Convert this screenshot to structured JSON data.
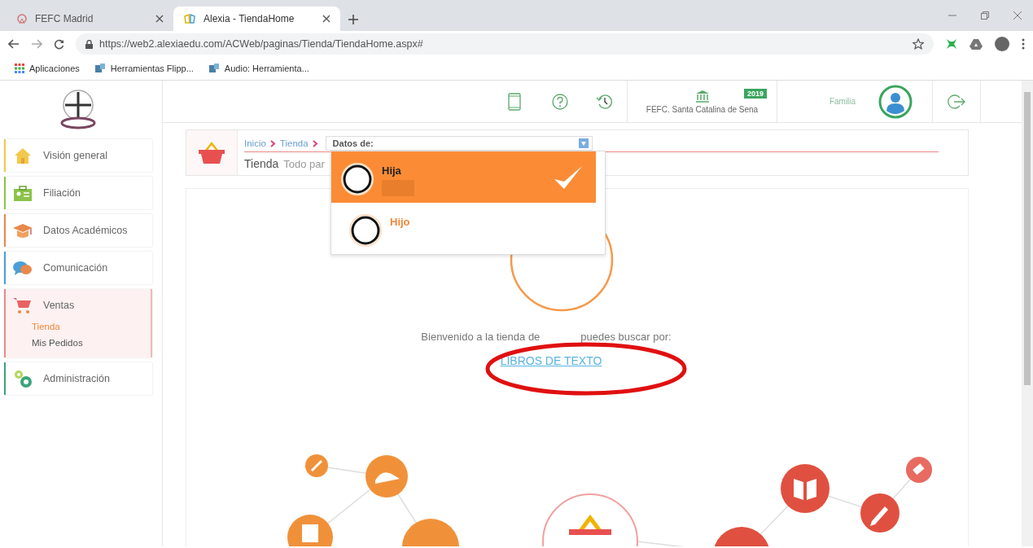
{
  "browser": {
    "tabs": [
      {
        "title": "FEFC Madrid",
        "selected": false
      },
      {
        "title": "Alexia - TiendaHome",
        "selected": true
      }
    ],
    "url": "https://web2.alexiaedu.com/ACWeb/paginas/Tienda/TiendaHome.aspx#",
    "bookmarks": [
      "Aplicaciones",
      "Herramientas Flipp...",
      "Audio: Herramienta..."
    ]
  },
  "header": {
    "school": "FEFC. Santa Catalina de Sena",
    "year": "2019",
    "role": "Familia"
  },
  "sidebar": {
    "items": [
      {
        "label": "Visión general",
        "color": "#f2c94c",
        "selected": false
      },
      {
        "label": "Filiación",
        "color": "#8bc34a",
        "selected": false
      },
      {
        "label": "Datos Académicos",
        "color": "#e8884a",
        "selected": false
      },
      {
        "label": "Comunicación",
        "color": "#4a9fd8",
        "selected": false
      },
      {
        "label": "Ventas",
        "color": "#e88a8a",
        "selected": true,
        "children": [
          {
            "label": "Tienda",
            "selected": true
          },
          {
            "label": "Mis Pedidos",
            "selected": false
          }
        ]
      },
      {
        "label": "Administración",
        "color": "#3aa57a",
        "selected": false
      }
    ]
  },
  "breadcrumb": {
    "items": [
      "Inicio",
      "Tienda"
    ],
    "selector_label": "Datos de:",
    "title": "Tienda",
    "subtitle": "Todo par"
  },
  "student_menu": {
    "options": [
      {
        "name": "Hija",
        "selected": true
      },
      {
        "name": "Hijo",
        "selected": false
      }
    ]
  },
  "welcome": {
    "text_before": "Bienvenido a la tienda de",
    "text_after": "puedes buscar por:",
    "link": "LIBROS DE TEXTO"
  }
}
